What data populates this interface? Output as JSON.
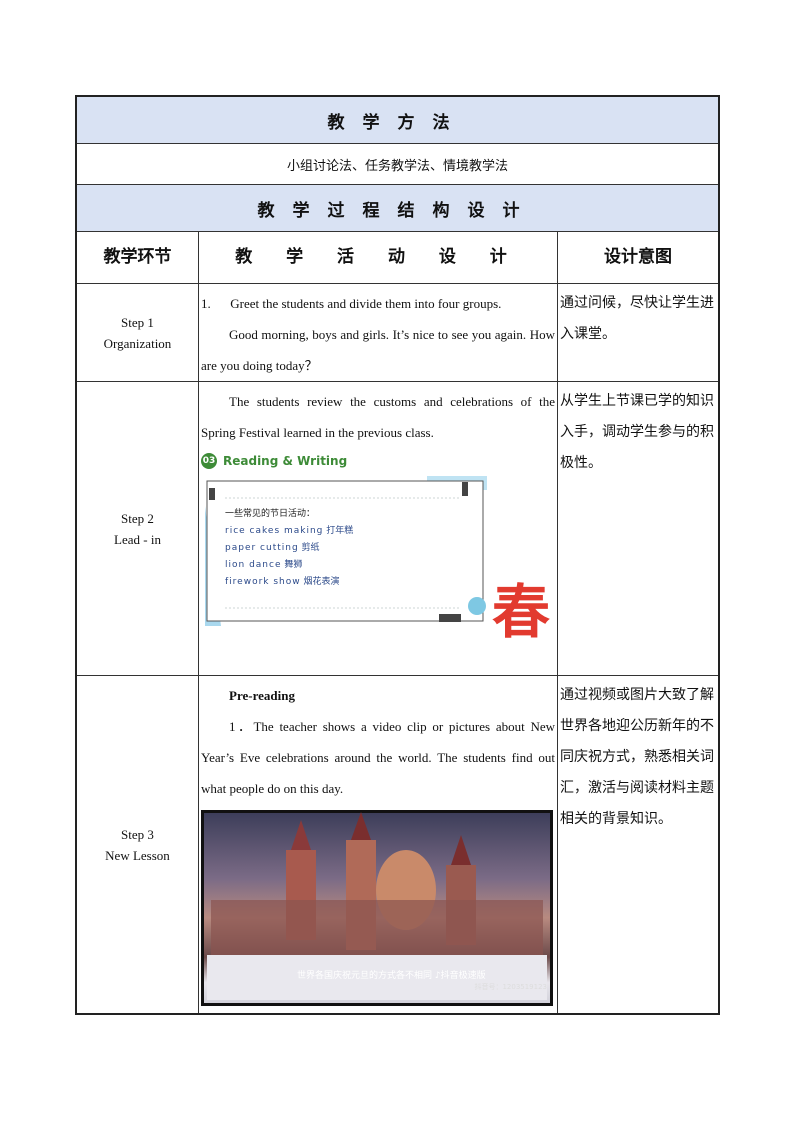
{
  "methods": {
    "title": "教学方法",
    "content": "小组讨论法、任务教学法、情境教学法"
  },
  "process": {
    "title": "教学过程结构设计"
  },
  "columns": {
    "stage": "教学环节",
    "activity": "教 学 活 动 设 计",
    "intent": "设计意图"
  },
  "steps": [
    {
      "stage_line1": "Step 1",
      "stage_line2": "Organization",
      "activity_p1": "1.      Greet the students and divide them into four groups.",
      "activity_p2": "Good morning, boys and girls.  It’s nice to see you again. How are you doing today？",
      "intent": "通过问候，尽快让学生进入课堂。"
    },
    {
      "stage_line1": "Step 2",
      "stage_line2": "Lead - in",
      "activity_p1": "The students review the customs and celebrations of the Spring Festival learned in the previous class.",
      "badge_num": "03",
      "badge_label": "Reading & Writing",
      "card_title": "一些常见的节日活动：",
      "card_items": [
        {
          "en": "rice cakes making",
          "zh": "打年糕"
        },
        {
          "en": "paper cutting",
          "zh": "剪纸"
        },
        {
          "en": "lion dance",
          "zh": "舞狮"
        },
        {
          "en": "firework show",
          "zh": "烟花表演"
        }
      ],
      "seal_char": "春",
      "intent": "从学生上节课已学的知识入手，调动学生参与的积极性。"
    },
    {
      "stage_line1": "Step 3",
      "stage_line2": "New Lesson",
      "activity_heading": "Pre-reading",
      "activity_p1": "1．The teacher shows a video clip  or pictures about New Year’s Eve celebrations around the world. The students find out what people do on this day.",
      "photo_caption": "世界各国庆祝元旦的方式各不相同",
      "photo_brand": "抖音极速版",
      "photo_id": "抖音号：1203519123",
      "intent": "通过视频或图片大致了解世界各地迎公历新年的不同庆祝方式，熟悉相关词汇，激活与阅读材料主题相关的背景知识。"
    }
  ],
  "colors": {
    "band": "#d9e2f3",
    "badge_green": "#3d8b37",
    "card_blue": "#2c4a8a",
    "seal_red": "#e23a2f",
    "accent_cyan": "#7ec8e3"
  }
}
